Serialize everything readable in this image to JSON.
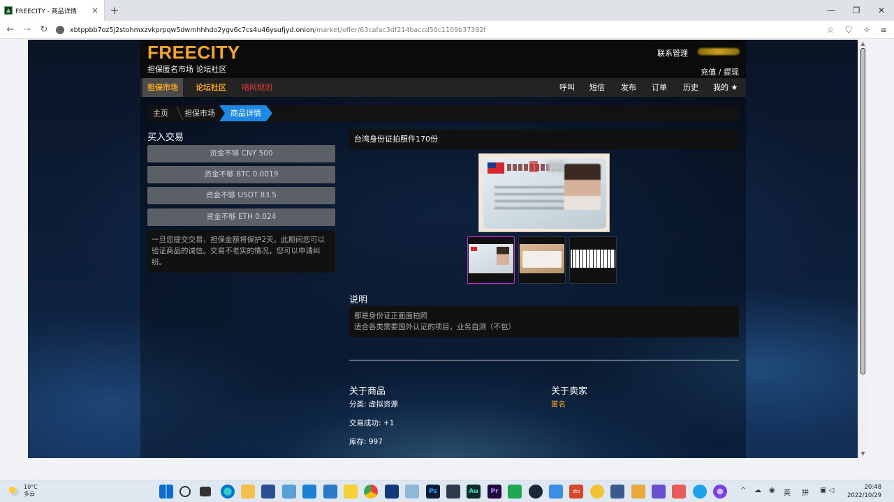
{
  "browser": {
    "tab_title": "FREECITY - 商品详情",
    "tab_close": "×",
    "new_tab": "+",
    "url_host": "xbtppbb7oz5j2stohmxzvkprpqw5dwmhhhdo2ygv6c7cs4u46ysufjyd.onion",
    "url_path": "/market/offer/63cafac3df214baccd50c1109b37392f",
    "back": "←",
    "forward": "→",
    "reload": "↻",
    "minimize": "—",
    "maximize": "❐",
    "close": "✕",
    "toolbar_icons": [
      "☆",
      "⛉",
      "✧",
      "≡"
    ]
  },
  "header": {
    "logo": "FREECITY",
    "tagline": "担保匿名市场 论坛社区",
    "contact": "联系管理",
    "recharge": "充值 / 提现"
  },
  "nav": {
    "left": [
      {
        "label": "担保市场"
      },
      {
        "label": "论坛社区"
      },
      {
        "label": "暗网规则"
      }
    ],
    "right": [
      {
        "label": "呼叫"
      },
      {
        "label": "短信"
      },
      {
        "label": "发布"
      },
      {
        "label": "订单"
      },
      {
        "label": "历史"
      },
      {
        "label": "我的 ★"
      }
    ]
  },
  "breadcrumb": {
    "items": [
      "主页",
      "担保市场",
      "商品详情"
    ]
  },
  "buy": {
    "title": "买入交易",
    "buttons": [
      {
        "label": "资金不够 CNY 500"
      },
      {
        "label": "资金不够 BTC 0.0019"
      },
      {
        "label": "资金不够 USDT 83.5"
      },
      {
        "label": "资金不够 ETH 0.024"
      }
    ],
    "notice": "一旦您提交交易，担保金额将保护2天。此期间您可以验证商品的诚信。交易不老实的情况，您可以申请纠纷。"
  },
  "product": {
    "title": "台湾身份证拍照件170份",
    "thumbnails": [
      "id-front",
      "id-back",
      "document"
    ],
    "description_title": "说明",
    "description_lines": [
      "都是身份证正面面拍照",
      "适合各类需要国外认证的项目，业务自测（不包）"
    ]
  },
  "about": {
    "product_title": "关于商品",
    "category": "分类: 虚拟资源",
    "success": "交易成功: +1",
    "stock": "库存: 997",
    "seller_title": "关于卖家",
    "seller_name": "匿名"
  },
  "taskbar": {
    "temp": "10°C",
    "weather": "多云",
    "time": "20:48",
    "date": "2022/10/29",
    "tray_lang1": "英",
    "tray_lang2": "拼"
  },
  "colors": {
    "accent_gold": "#f5a623",
    "breadcrumb_active": "#1e88e5",
    "rules_red": "#e53935",
    "thumb_selected": "#c42bd6"
  }
}
